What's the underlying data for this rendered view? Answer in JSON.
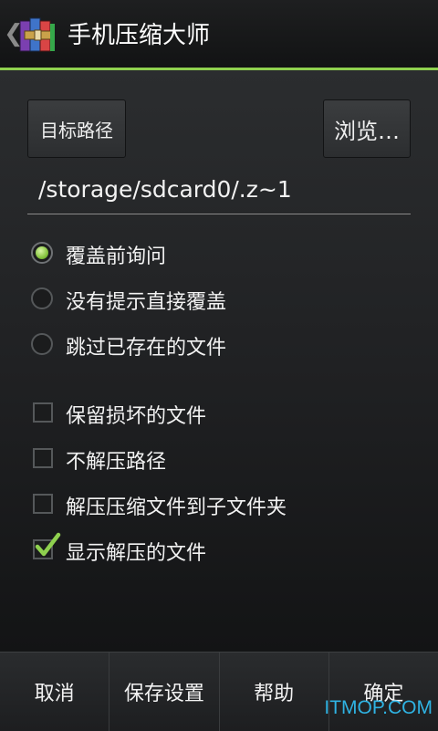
{
  "appbar": {
    "title": "手机压缩大师",
    "back_icon": "chevron-left-icon",
    "app_icon": "archive-books-icon"
  },
  "target": {
    "button_label": "目标路径",
    "browse_label": "浏览…",
    "path_value": "/storage/sdcard0/.z~1"
  },
  "overwrite_options": [
    {
      "label": "覆盖前询问",
      "selected": true
    },
    {
      "label": "没有提示直接覆盖",
      "selected": false
    },
    {
      "label": "跳过已存在的文件",
      "selected": false
    }
  ],
  "checkboxes": [
    {
      "label": "保留损坏的文件",
      "checked": false
    },
    {
      "label": "不解压路径",
      "checked": false
    },
    {
      "label": "解压压缩文件到子文件夹",
      "checked": false
    },
    {
      "label": "显示解压的文件",
      "checked": true
    }
  ],
  "bottom_bar": {
    "cancel": "取消",
    "save_settings": "保存设置",
    "help": "帮助",
    "ok": "确定"
  },
  "watermark": "ITMOP.COM",
  "colors": {
    "accent_green": "#8fd14f",
    "watermark_blue": "#2fb3e3"
  }
}
